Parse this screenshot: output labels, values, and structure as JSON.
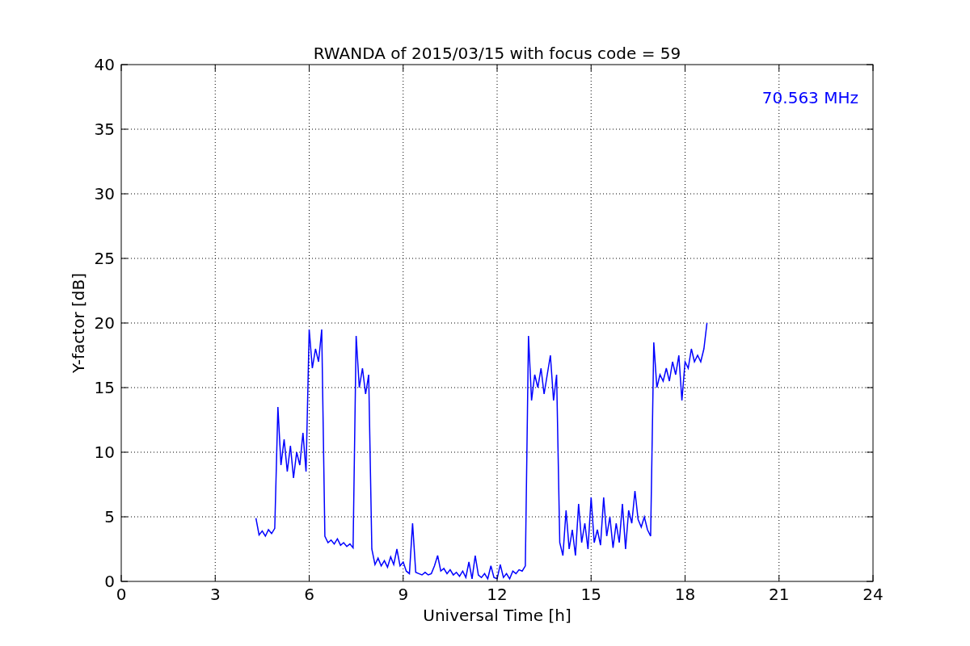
{
  "chart_data": {
    "type": "line",
    "title": "RWANDA of 2015/03/15 with focus code = 59",
    "xlabel": "Universal Time [h]",
    "ylabel": "Y-factor [dB]",
    "xlim": [
      0,
      24
    ],
    "ylim": [
      0,
      40
    ],
    "xticks": [
      0,
      3,
      6,
      9,
      12,
      15,
      18,
      21,
      24
    ],
    "yticks": [
      0,
      5,
      10,
      15,
      20,
      25,
      30,
      35,
      40
    ],
    "x": [
      4.3,
      4.4,
      4.5,
      4.6,
      4.7,
      4.8,
      4.9,
      5.0,
      5.1,
      5.2,
      5.3,
      5.4,
      5.5,
      5.6,
      5.7,
      5.8,
      5.9,
      6.0,
      6.1,
      6.2,
      6.3,
      6.4,
      6.5,
      6.6,
      6.7,
      6.8,
      6.9,
      7.0,
      7.1,
      7.2,
      7.3,
      7.4,
      7.5,
      7.6,
      7.7,
      7.8,
      7.9,
      8.0,
      8.1,
      8.2,
      8.3,
      8.4,
      8.5,
      8.6,
      8.7,
      8.8,
      8.9,
      9.0,
      9.1,
      9.2,
      9.3,
      9.4,
      9.5,
      9.6,
      9.7,
      9.8,
      9.9,
      10.0,
      10.1,
      10.2,
      10.3,
      10.4,
      10.5,
      10.6,
      10.7,
      10.8,
      10.9,
      11.0,
      11.1,
      11.2,
      11.3,
      11.4,
      11.5,
      11.6,
      11.7,
      11.8,
      11.9,
      12.0,
      12.1,
      12.2,
      12.3,
      12.4,
      12.5,
      12.6,
      12.7,
      12.8,
      12.9,
      13.0,
      13.1,
      13.2,
      13.3,
      13.4,
      13.5,
      13.6,
      13.7,
      13.8,
      13.9,
      14.0,
      14.1,
      14.2,
      14.3,
      14.4,
      14.5,
      14.6,
      14.7,
      14.8,
      14.9,
      15.0,
      15.1,
      15.2,
      15.3,
      15.4,
      15.5,
      15.6,
      15.7,
      15.8,
      15.9,
      16.0,
      16.1,
      16.2,
      16.3,
      16.4,
      16.5,
      16.6,
      16.7,
      16.8,
      16.9,
      17.0,
      17.1,
      17.2,
      17.3,
      17.4,
      17.5,
      17.6,
      17.7,
      17.8,
      17.9,
      18.0,
      18.1,
      18.2,
      18.3,
      18.4,
      18.5,
      18.6,
      18.7
    ],
    "series": [
      {
        "name": "70.563 MHz",
        "color": "#0000ff",
        "values": [
          4.9,
          3.6,
          3.9,
          3.5,
          4.0,
          3.7,
          4.1,
          13.5,
          9.0,
          11,
          8.5,
          10.5,
          8.0,
          10,
          9,
          11.5,
          8.5,
          19.5,
          16.5,
          18,
          17,
          19.5,
          3.5,
          3.0,
          3.2,
          2.9,
          3.3,
          2.8,
          3.0,
          2.7,
          2.9,
          2.6,
          19,
          15,
          16.5,
          14.5,
          16,
          2.5,
          1.3,
          1.8,
          1.2,
          1.6,
          1.1,
          1.9,
          1.3,
          2.5,
          1.2,
          1.5,
          0.8,
          0.6,
          4.5,
          0.7,
          0.6,
          0.5,
          0.7,
          0.5,
          0.6,
          1.2,
          2.0,
          0.8,
          1.0,
          0.6,
          0.9,
          0.5,
          0.7,
          0.4,
          0.8,
          0.3,
          1.5,
          0.2,
          2.0,
          0.5,
          0.3,
          0.6,
          0.2,
          1.2,
          0.3,
          0.2,
          1.3,
          0.3,
          0.6,
          0.2,
          0.8,
          0.6,
          0.9,
          0.8,
          1.2,
          19,
          14,
          16,
          15,
          16.5,
          14.5,
          16,
          17.5,
          14,
          16,
          3.0,
          2.0,
          5.5,
          2.5,
          4.0,
          2.0,
          6.0,
          3.0,
          4.5,
          2.5,
          6.5,
          3.0,
          4.0,
          2.8,
          6.5,
          3.5,
          5.0,
          2.6,
          4.5,
          3.0,
          6.0,
          2.5,
          5.5,
          4.5,
          7.0,
          4.8,
          4.2,
          5.0,
          4.0,
          3.5,
          18.5,
          15,
          16,
          15.5,
          16.5,
          15.5,
          17,
          16,
          17.5,
          14,
          17,
          16.5,
          18,
          17,
          17.5,
          17,
          18,
          20
        ]
      }
    ],
    "grid": true
  }
}
